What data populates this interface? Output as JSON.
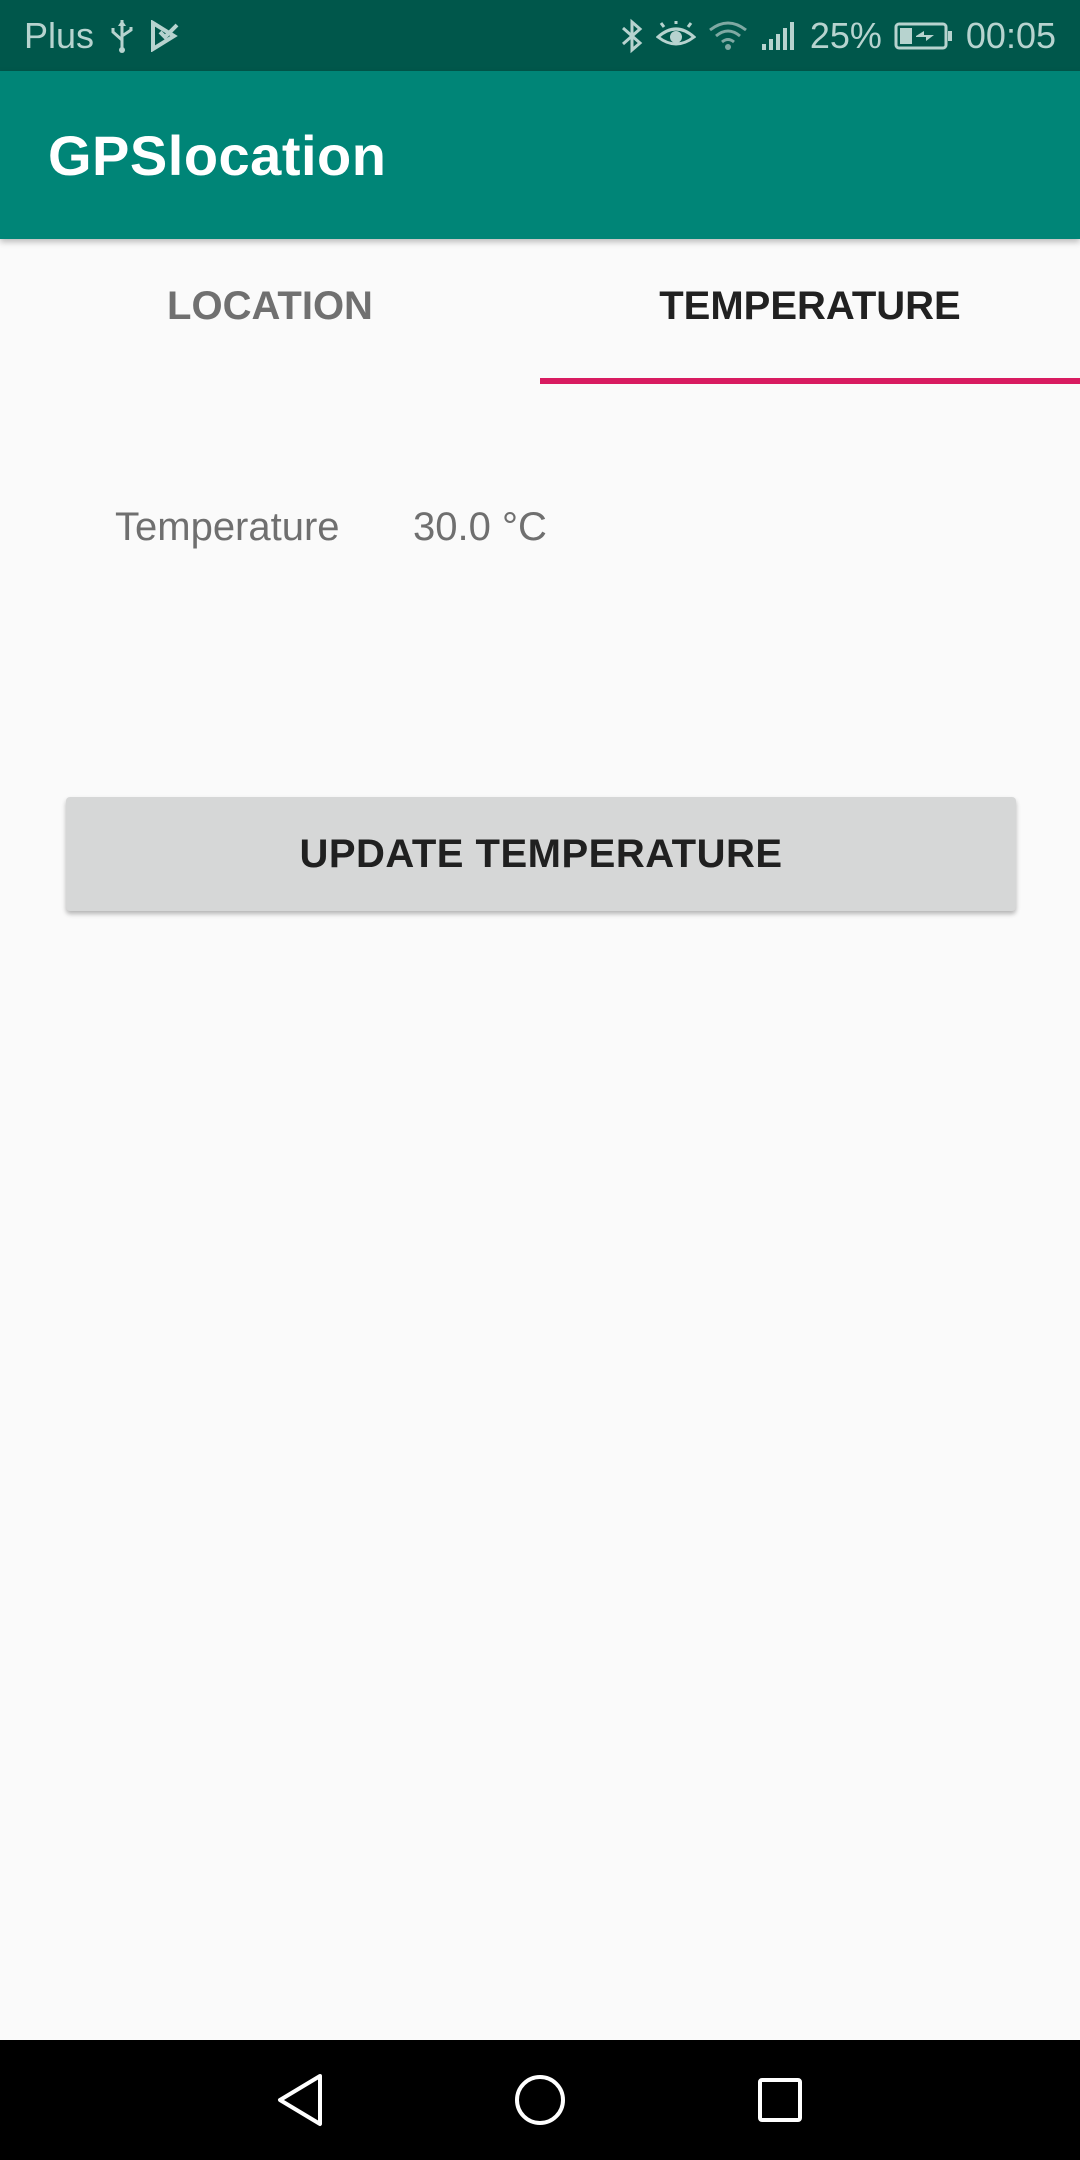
{
  "status_bar": {
    "carrier": "Plus",
    "battery": "25%",
    "time": "00:05",
    "icons": [
      "usb-icon",
      "notification-icon",
      "bluetooth-icon",
      "eye-icon",
      "wifi-icon",
      "signal-icon",
      "battery-icon"
    ]
  },
  "app_bar": {
    "title": "GPSlocation"
  },
  "tabs": [
    {
      "label": "LOCATION",
      "active": false
    },
    {
      "label": "TEMPERATURE",
      "active": true
    }
  ],
  "temperature": {
    "label": "Temperature",
    "value": "30.0 °C"
  },
  "update_button": {
    "label": "UPDATE TEMPERATURE"
  },
  "nav_bar": {
    "icons": [
      "back-icon",
      "home-icon",
      "recents-icon"
    ]
  },
  "colors": {
    "status_bar": "#00574b",
    "app_bar": "#008577",
    "tab_indicator": "#d81b60",
    "button": "#d6d7d7",
    "background": "#fafafa"
  }
}
